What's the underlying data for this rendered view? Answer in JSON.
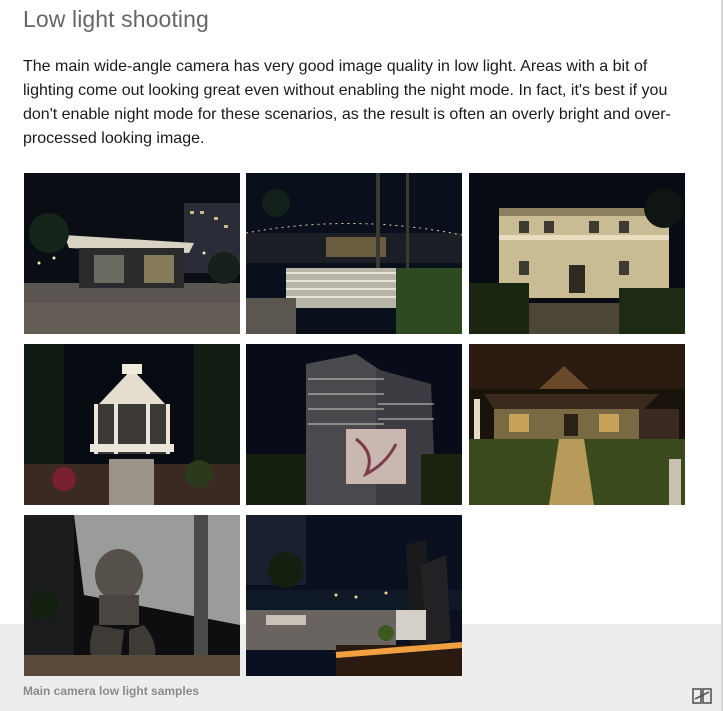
{
  "article": {
    "heading": "Low light shooting",
    "paragraph": "The main wide-angle camera has very good image quality in low light. Areas with a bit of lighting come out looking great even without enabling the night mode. In fact, it's best if you don't enable night mode for these scenarios, as the result is often an overly bright and over-processed looking image."
  },
  "gallery": {
    "caption": "Main camera low light samples",
    "icon": "gallery-toggle-icon"
  }
}
